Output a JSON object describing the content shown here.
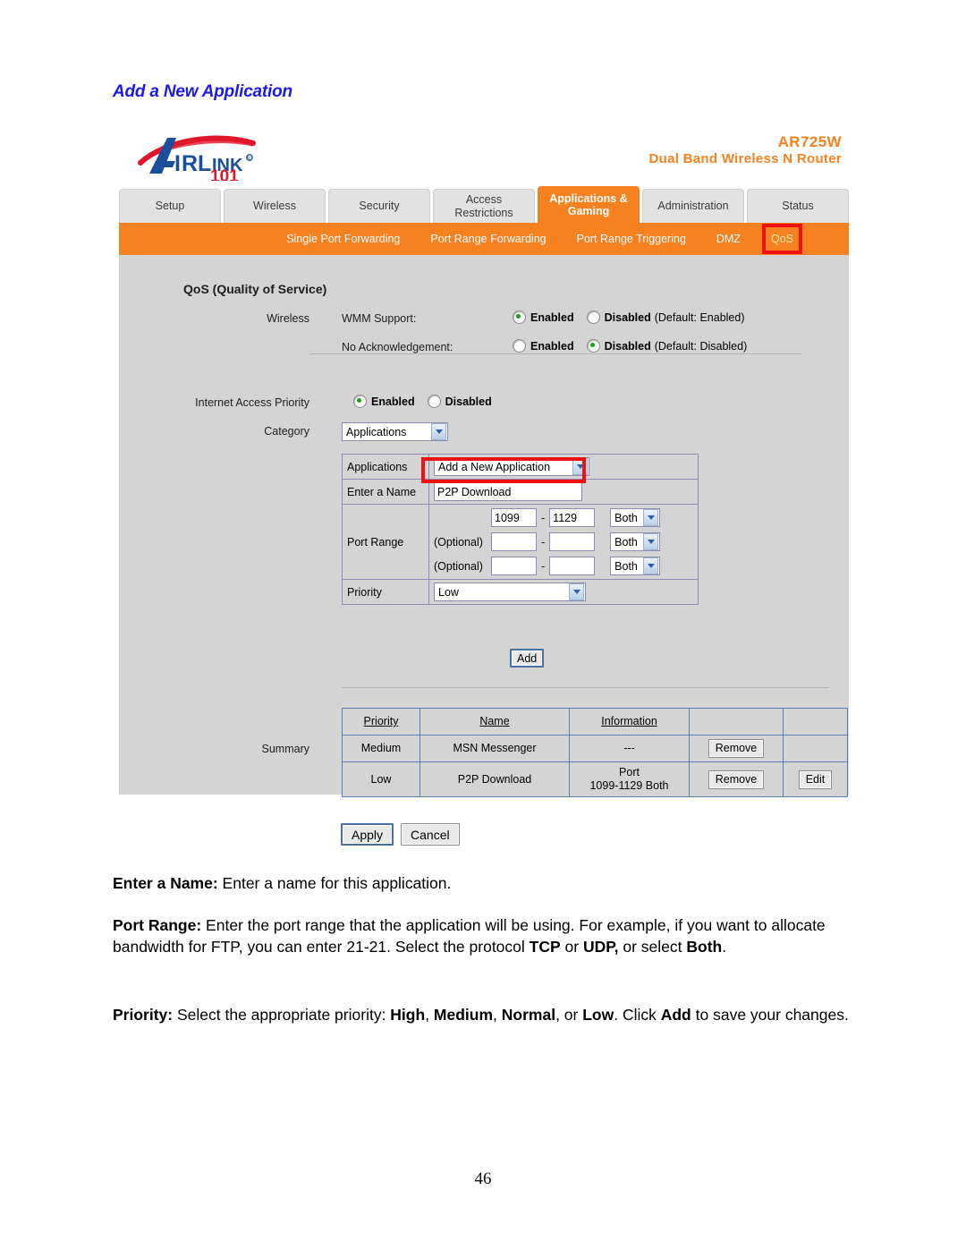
{
  "page": {
    "heading": "Add a New Application",
    "number": "46"
  },
  "router": {
    "brand": {
      "logo_primary": "A",
      "logo_word": "IRLINK",
      "logo_reg": "®",
      "logo_suffix": "101"
    },
    "model": {
      "name": "AR725W",
      "description": "Dual Band Wireless N Router"
    },
    "tabs": [
      {
        "label": "Setup",
        "active": false
      },
      {
        "label": "Wireless",
        "active": false
      },
      {
        "label": "Security",
        "active": false
      },
      {
        "label": "Access Restrictions",
        "active": false
      },
      {
        "label": "Applications & Gaming",
        "active": true
      },
      {
        "label": "Administration",
        "active": false
      },
      {
        "label": "Status",
        "active": false
      }
    ],
    "subnav": [
      {
        "label": "Single Port Forwarding",
        "highlighted": false
      },
      {
        "label": "Port Range Forwarding",
        "highlighted": false
      },
      {
        "label": "Port Range Triggering",
        "highlighted": false
      },
      {
        "label": "DMZ",
        "highlighted": false
      },
      {
        "label": "QoS",
        "highlighted": true
      }
    ],
    "qos": {
      "section_title": "QoS (Quality of Service)",
      "wireless_label": "Wireless",
      "wmm": {
        "label": "WMM Support:",
        "enabled_label": "Enabled",
        "disabled_label": "Disabled",
        "note": "(Default: Enabled)",
        "selected": "Enabled"
      },
      "no_ack": {
        "label": "No Acknowledgement:",
        "enabled_label": "Enabled",
        "disabled_label": "Disabled",
        "note": "(Default: Disabled)",
        "selected": "Disabled"
      },
      "internet_access_priority": {
        "label": "Internet Access Priority",
        "enabled_label": "Enabled",
        "disabled_label": "Disabled",
        "selected": "Enabled"
      },
      "category": {
        "label": "Category",
        "value": "Applications"
      },
      "applications": {
        "label": "Applications",
        "value": "Add a New Application"
      },
      "enter_name": {
        "label": "Enter a Name",
        "value": "P2P Download"
      },
      "port_range": {
        "label": "Port Range",
        "optional_label": "(Optional)",
        "separator": "-",
        "rows": [
          {
            "start": "1099",
            "end": "1129",
            "protocol": "Both",
            "optional": false
          },
          {
            "start": "",
            "end": "",
            "protocol": "Both",
            "optional": true
          },
          {
            "start": "",
            "end": "",
            "protocol": "Both",
            "optional": true
          }
        ]
      },
      "priority": {
        "label": "Priority",
        "value": "Low"
      },
      "add_button": "Add",
      "summary": {
        "label": "Summary",
        "headers": [
          "Priority",
          "Name",
          "Information",
          "",
          ""
        ],
        "rows": [
          {
            "priority": "Medium",
            "name": "MSN Messenger",
            "information": "---",
            "information_line2": "",
            "remove": "Remove",
            "edit": ""
          },
          {
            "priority": "Low",
            "name": "P2P Download",
            "information": "Port",
            "information_line2": "1099-1129   Both",
            "remove": "Remove",
            "edit": "Edit"
          }
        ]
      }
    },
    "footer_buttons": {
      "apply": "Apply",
      "cancel": "Cancel"
    }
  },
  "descriptions": [
    {
      "term": "Enter a Name:",
      "text": " Enter a name for this application."
    },
    {
      "term": "Port Range:",
      "text": " Enter the port range that the application will be using. For example, if you want to allocate bandwidth for FTP, you can enter 21-21. Select the protocol TCP or UDP, or select Both."
    },
    {
      "term": "Priority:",
      "text": " Select the appropriate priority: High, Medium, Normal, or Low. Click Add to save your changes."
    }
  ],
  "colors": {
    "accent_orange": "#f68121",
    "heading_blue": "#1a1aef",
    "highlight_red": "#ee1111",
    "panel_gray": "#d4d4d4",
    "radio_green": "#18a018"
  }
}
